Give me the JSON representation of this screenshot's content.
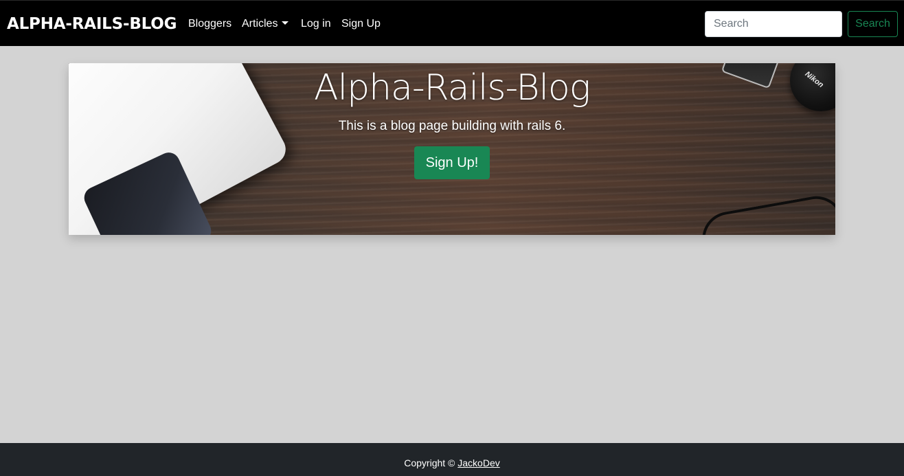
{
  "navbar": {
    "brand": "ALPHA-RAILS-BLOG",
    "links": {
      "bloggers": "Bloggers",
      "articles": "Articles",
      "login": "Log in",
      "signup": "Sign Up"
    },
    "search": {
      "placeholder": "Search",
      "button_label": "Search"
    }
  },
  "hero": {
    "title": "Alpha-Rails-Blog",
    "subtitle": "This is a blog page building with rails 6.",
    "button_label": "Sign Up!",
    "decor_lens_text": "Nikon"
  },
  "footer": {
    "copyright_prefix": "Copyright ©",
    "author_link": "JackoDev"
  },
  "colors": {
    "navbar_bg": "#000000",
    "page_bg": "#d3d3d3",
    "accent_green": "#198754",
    "footer_bg": "#212529"
  }
}
